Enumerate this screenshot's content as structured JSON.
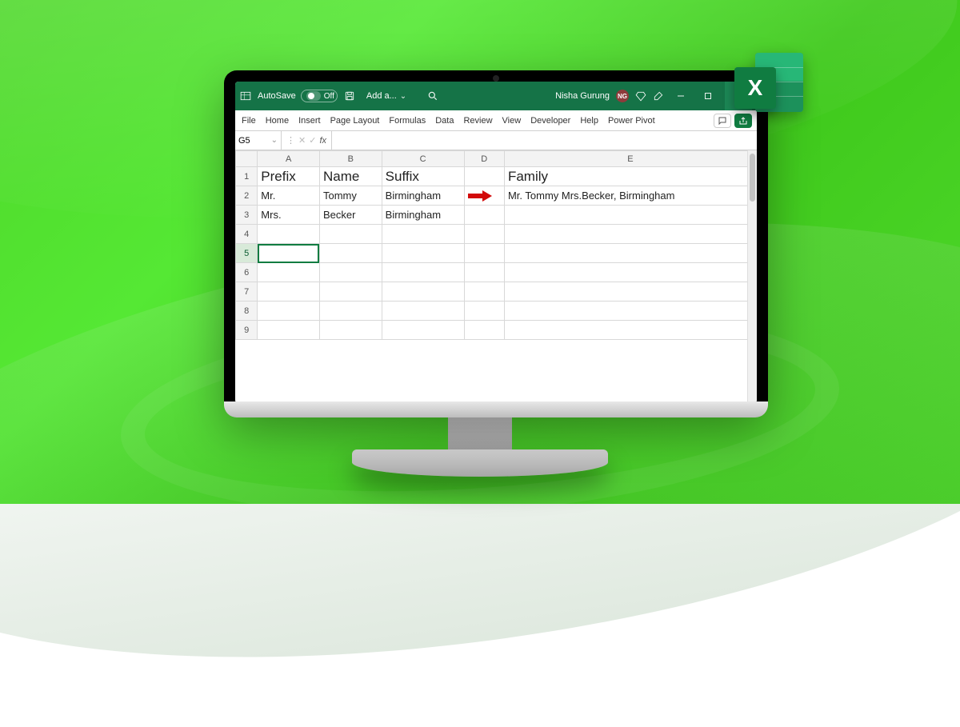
{
  "titlebar": {
    "autosave_label": "AutoSave",
    "autosave_state": "Off",
    "add_label": "Add a...",
    "user_name": "Nisha Gurung",
    "user_initials": "NG"
  },
  "ribbon": {
    "tabs": [
      "File",
      "Home",
      "Insert",
      "Page Layout",
      "Formulas",
      "Data",
      "Review",
      "View",
      "Developer",
      "Help",
      "Power Pivot"
    ]
  },
  "formula_bar": {
    "cell_ref": "G5",
    "fx": "fx",
    "value": ""
  },
  "grid": {
    "columns": [
      "A",
      "B",
      "C",
      "D",
      "E"
    ],
    "rows": [
      {
        "n": "1",
        "A": "Prefix",
        "B": "Name",
        "C": "Suffix",
        "D": "",
        "E": "Family",
        "header": true
      },
      {
        "n": "2",
        "A": "Mr.",
        "B": "Tommy",
        "C": "Birmingham",
        "D": "ARROW",
        "E": "Mr. Tommy  Mrs.Becker, Birmingham"
      },
      {
        "n": "3",
        "A": "Mrs.",
        "B": "Becker",
        "C": "Birmingham",
        "D": "",
        "E": ""
      },
      {
        "n": "4",
        "A": "",
        "B": "",
        "C": "",
        "D": "",
        "E": ""
      },
      {
        "n": "5",
        "A": "",
        "B": "",
        "C": "",
        "D": "",
        "E": "",
        "selected": true
      },
      {
        "n": "6",
        "A": "",
        "B": "",
        "C": "",
        "D": "",
        "E": ""
      },
      {
        "n": "7",
        "A": "",
        "B": "",
        "C": "",
        "D": "",
        "E": ""
      },
      {
        "n": "8",
        "A": "",
        "B": "",
        "C": "",
        "D": "",
        "E": ""
      },
      {
        "n": "9",
        "A": "",
        "B": "",
        "C": "",
        "D": "",
        "E": ""
      }
    ]
  },
  "excel_icon": {
    "letter": "X"
  }
}
